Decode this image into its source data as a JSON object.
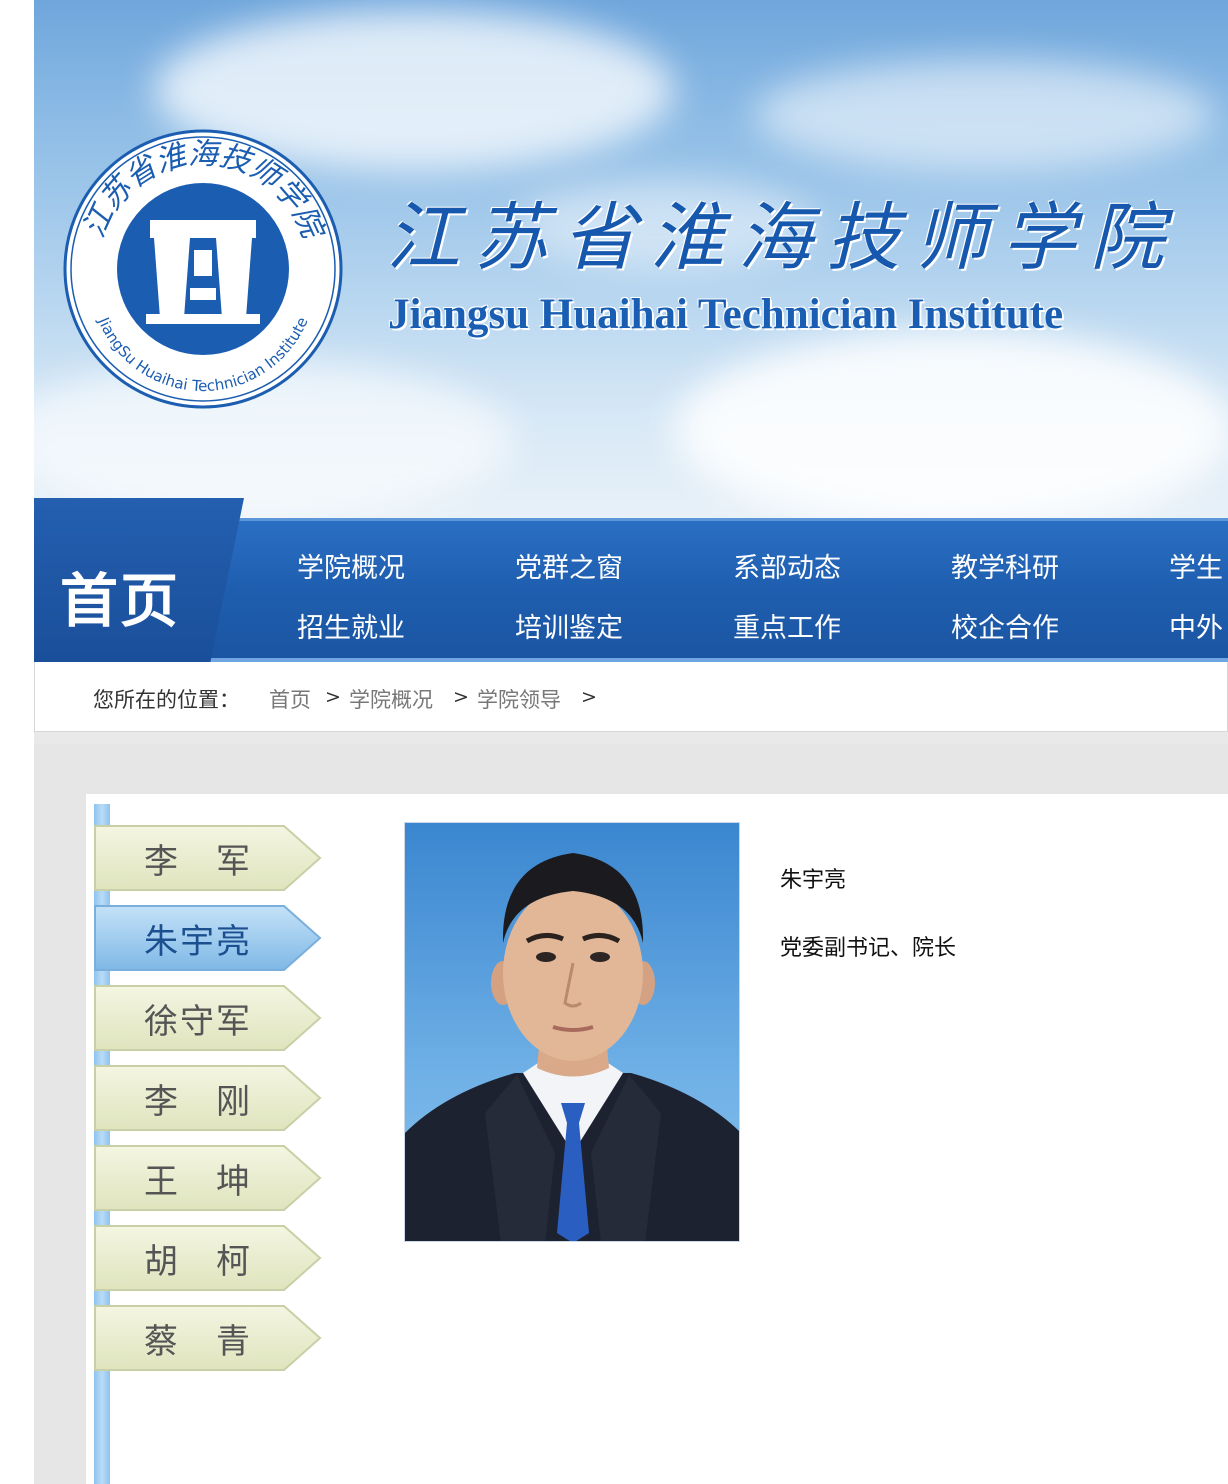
{
  "header": {
    "title_cn": "江苏省淮海技师学院",
    "title_en": "Jiangsu Huaihai Technician Institute",
    "logo_ring_text": "JiangSu Huaihai Technician Institute",
    "logo_ring_text_cn": "江苏省淮海技师学院"
  },
  "nav": {
    "home": "首页",
    "items": [
      {
        "label": "学院概况"
      },
      {
        "label": "党群之窗"
      },
      {
        "label": "系部动态"
      },
      {
        "label": "教学科研"
      },
      {
        "label": "学生"
      },
      {
        "label": "招生就业"
      },
      {
        "label": "培训鉴定"
      },
      {
        "label": "重点工作"
      },
      {
        "label": "校企合作"
      },
      {
        "label": "中外"
      }
    ]
  },
  "breadcrumb": {
    "lead": "您所在的位置：",
    "items": [
      "首页",
      "学院概况",
      "学院领导"
    ],
    "separator": ">"
  },
  "leaders": [
    {
      "name": "李　军",
      "active": false
    },
    {
      "name": "朱宇亮",
      "active": true
    },
    {
      "name": "徐守军",
      "active": false
    },
    {
      "name": "李　刚",
      "active": false
    },
    {
      "name": "王　坤",
      "active": false
    },
    {
      "name": "胡　柯",
      "active": false
    },
    {
      "name": "蔡　青",
      "active": false
    }
  ],
  "profile": {
    "name": "朱宇亮",
    "position": "党委副书记、院长",
    "photo_icon": "portrait-photo"
  },
  "colors": {
    "nav_blue": "#1f5eaf",
    "title_blue": "#1658ad",
    "tab_inactive": "#e8ecc8",
    "tab_active": "#8cc0ea"
  }
}
